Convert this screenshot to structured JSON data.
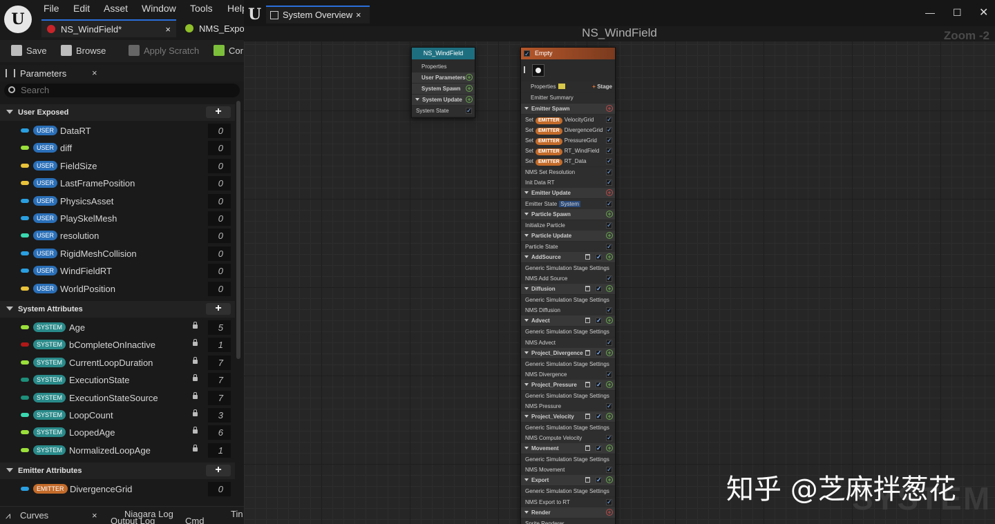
{
  "menu": [
    "File",
    "Edit",
    "Asset",
    "Window",
    "Tools",
    "Help"
  ],
  "doc_tabs": [
    {
      "label": "NS_WindField*",
      "close": "×"
    },
    {
      "label": "NMS_Expo"
    }
  ],
  "toolbar": {
    "save": "Save",
    "browse": "Browse",
    "apply_scratch": "Apply Scratch",
    "compile": "Cor"
  },
  "params_panel": {
    "title": "Parameters",
    "close": "×",
    "search_placeholder": "Search",
    "sections": [
      {
        "title": "User Exposed",
        "items": [
          {
            "badge": "USER",
            "name": "DataRT",
            "value": "0",
            "color": "#2a9fe0"
          },
          {
            "badge": "USER",
            "name": "diff",
            "value": "0",
            "color": "#9be03a"
          },
          {
            "badge": "USER",
            "name": "FieldSize",
            "value": "0",
            "color": "#e8c23a"
          },
          {
            "badge": "USER",
            "name": "LastFramePosition",
            "value": "0",
            "color": "#e8c23a"
          },
          {
            "badge": "USER",
            "name": "PhysicsAsset",
            "value": "0",
            "color": "#2a9fe0"
          },
          {
            "badge": "USER",
            "name": "PlaySkelMesh",
            "value": "0",
            "color": "#2a9fe0"
          },
          {
            "badge": "USER",
            "name": "resolution",
            "value": "0",
            "color": "#3ad8b0"
          },
          {
            "badge": "USER",
            "name": "RigidMeshCollision",
            "value": "0",
            "color": "#2a9fe0"
          },
          {
            "badge": "USER",
            "name": "WindFieldRT",
            "value": "0",
            "color": "#2a9fe0"
          },
          {
            "badge": "USER",
            "name": "WorldPosition",
            "value": "0",
            "color": "#e8c23a"
          }
        ]
      },
      {
        "title": "System Attributes",
        "items": [
          {
            "badge": "SYSTEM",
            "name": "Age",
            "value": "5",
            "color": "#9be03a"
          },
          {
            "badge": "SYSTEM",
            "name": "bCompleteOnInactive",
            "value": "1",
            "color": "#b01818"
          },
          {
            "badge": "SYSTEM",
            "name": "CurrentLoopDuration",
            "value": "7",
            "color": "#9be03a"
          },
          {
            "badge": "SYSTEM",
            "name": "ExecutionState",
            "value": "7",
            "color": "#1d8f7a"
          },
          {
            "badge": "SYSTEM",
            "name": "ExecutionStateSource",
            "value": "7",
            "color": "#1d8f7a"
          },
          {
            "badge": "SYSTEM",
            "name": "LoopCount",
            "value": "3",
            "color": "#3ad8b0"
          },
          {
            "badge": "SYSTEM",
            "name": "LoopedAge",
            "value": "6",
            "color": "#9be03a"
          },
          {
            "badge": "SYSTEM",
            "name": "NormalizedLoopAge",
            "value": "1",
            "color": "#9be03a"
          }
        ]
      },
      {
        "title": "Emitter Attributes",
        "items": [
          {
            "badge": "EMITTER",
            "name": "DivergenceGrid",
            "value": "0",
            "color": "#2a9fe0"
          }
        ]
      }
    ]
  },
  "bottom_tabs": [
    "Curves",
    "Niagara Log",
    "Output Log",
    "Cmd",
    "Tin"
  ],
  "graph_tab": {
    "label": "System Overview",
    "close": "×"
  },
  "graph": {
    "title": "NS_WindField",
    "zoom": "Zoom -2",
    "system_node": {
      "title": "NS_WindField",
      "rows": [
        "Properties",
        "User Parameters",
        "System Spawn",
        "System Update",
        "System State"
      ]
    },
    "emitter_node": {
      "title": "Empty",
      "properties": "Properties",
      "stage": "Stage",
      "summary": "Emitter Summary",
      "tag": "EMITTER",
      "set": "Set",
      "rows": [
        {
          "t": "hdr",
          "label": "Emitter Spawn",
          "add": "red"
        },
        {
          "t": "set",
          "label": "VelocityGrid"
        },
        {
          "t": "set",
          "label": "DivergenceGrid"
        },
        {
          "t": "set",
          "label": "PressureGrid"
        },
        {
          "t": "set",
          "label": "RT_WindField"
        },
        {
          "t": "set",
          "label": "RT_Data"
        },
        {
          "t": "item",
          "label": "NMS Set Resolution"
        },
        {
          "t": "item",
          "label": "Init Data RT"
        },
        {
          "t": "hdr",
          "label": "Emitter Update",
          "add": "red"
        },
        {
          "t": "item",
          "label": "Emitter State",
          "extra": "System"
        },
        {
          "t": "hdr",
          "label": "Particle Spawn",
          "add": "green"
        },
        {
          "t": "item",
          "label": "Initialize Particle"
        },
        {
          "t": "hdr",
          "label": "Particle Update",
          "add": "green"
        },
        {
          "t": "item",
          "label": "Particle State"
        },
        {
          "t": "stage",
          "label": "AddSource"
        },
        {
          "t": "item",
          "label": "Generic Simulation Stage Settings",
          "nochk": true
        },
        {
          "t": "item",
          "label": "NMS Add Source"
        },
        {
          "t": "stage",
          "label": "Diffusion"
        },
        {
          "t": "item",
          "label": "Generic Simulation Stage Settings",
          "nochk": true
        },
        {
          "t": "item",
          "label": "NMS Diffusion"
        },
        {
          "t": "stage",
          "label": "Advect"
        },
        {
          "t": "item",
          "label": "Generic Simulation Stage Settings",
          "nochk": true
        },
        {
          "t": "item",
          "label": "NMS Advect"
        },
        {
          "t": "stage",
          "label": "Project_Divergence"
        },
        {
          "t": "item",
          "label": "Generic Simulation Stage Settings",
          "nochk": true
        },
        {
          "t": "item",
          "label": "NMS Divergence"
        },
        {
          "t": "stage",
          "label": "Project_Pressure"
        },
        {
          "t": "item",
          "label": "Generic Simulation Stage Settings",
          "nochk": true
        },
        {
          "t": "item",
          "label": "NMS Pressure"
        },
        {
          "t": "stage",
          "label": "Project_Velocity"
        },
        {
          "t": "item",
          "label": "Generic Simulation Stage Settings",
          "nochk": true
        },
        {
          "t": "item",
          "label": "NMS Compute Velocity"
        },
        {
          "t": "stage",
          "label": "Movement"
        },
        {
          "t": "item",
          "label": "Generic Simulation Stage Settings",
          "nochk": true
        },
        {
          "t": "item",
          "label": "NMS Movement"
        },
        {
          "t": "stage",
          "label": "Export"
        },
        {
          "t": "item",
          "label": "Generic Simulation Stage Settings",
          "nochk": true
        },
        {
          "t": "item",
          "label": "NMS Export to RT"
        },
        {
          "t": "hdr",
          "label": "Render",
          "add": "red"
        },
        {
          "t": "item",
          "label": "Sprite Renderer",
          "nochk": true
        }
      ]
    }
  },
  "watermark": "知乎 @芝麻拌葱花",
  "bg_mark": "SYSTEM",
  "colors": {
    "user_badge": "#2a6fb8",
    "system_badge": "#2a8a8a",
    "emitter_badge": "#c36b2a",
    "system_node_header": "#1d6f80",
    "emitter_node_header": "#b5572a"
  }
}
